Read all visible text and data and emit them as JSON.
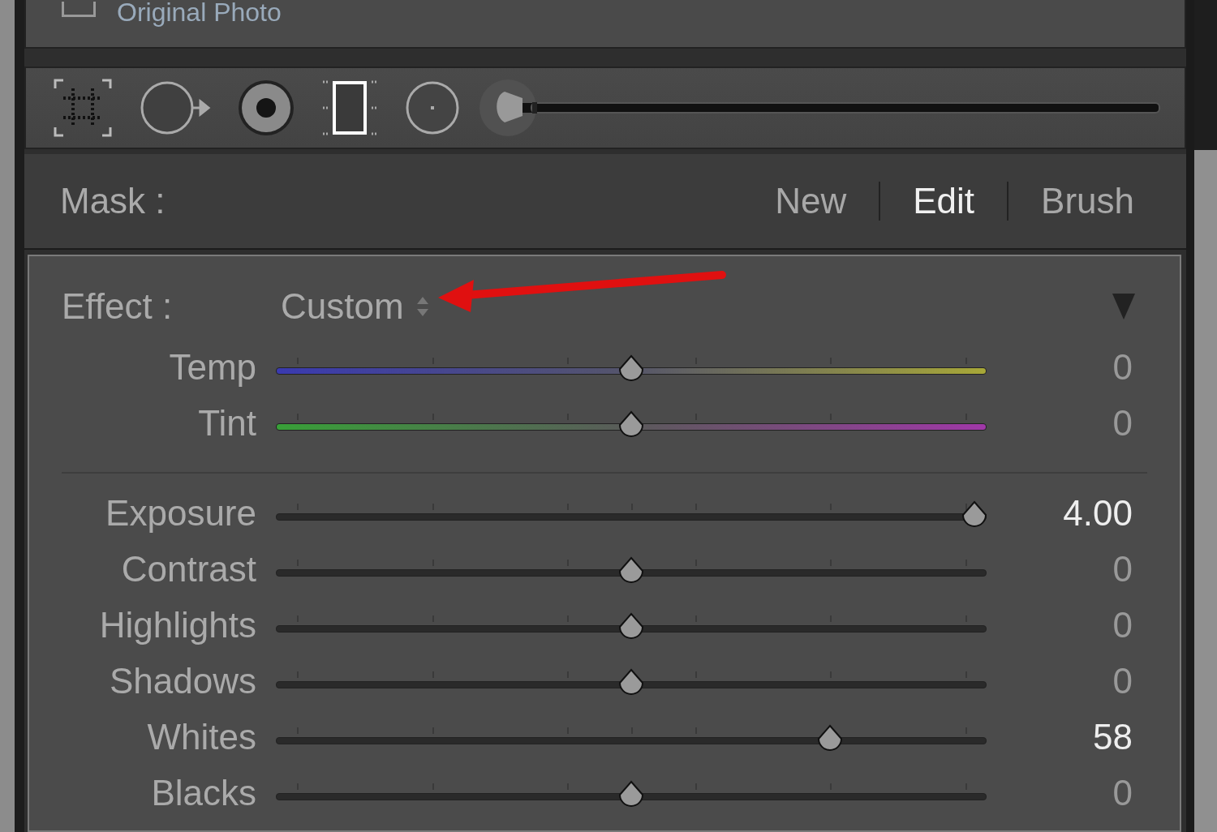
{
  "original_photo": {
    "label": "Original Photo",
    "checked": false
  },
  "tools": [
    {
      "kind": "marquee"
    },
    {
      "kind": "radial"
    },
    {
      "kind": "eye"
    },
    {
      "kind": "film"
    },
    {
      "kind": "dot"
    }
  ],
  "brush_size": {
    "level": 0
  },
  "mask": {
    "label": "Mask :",
    "tabs": [
      {
        "label": "New",
        "selected": false
      },
      {
        "label": "Edit",
        "selected": true
      },
      {
        "label": "Brush",
        "selected": false
      }
    ]
  },
  "effect": {
    "label": "Effect :",
    "value": "Custom",
    "expanded": true
  },
  "color_sliders": [
    {
      "kind": "temp",
      "label": "Temp",
      "level": 0.5,
      "reading": "0"
    },
    {
      "kind": "tint",
      "label": "Tint",
      "level": 0.5,
      "reading": "0"
    }
  ],
  "tone_sliders": [
    {
      "kind": "tone",
      "label": "Exposure",
      "level": 0.983,
      "reading": "4.00"
    },
    {
      "kind": "tone",
      "label": "Contrast",
      "level": 0.5,
      "reading": "0"
    },
    {
      "kind": "tone",
      "label": "Highlights",
      "level": 0.5,
      "reading": "0"
    },
    {
      "kind": "tone",
      "label": "Shadows",
      "level": 0.5,
      "reading": "0"
    },
    {
      "kind": "tone",
      "label": "Whites",
      "level": 0.78,
      "reading": "58"
    },
    {
      "kind": "tone",
      "label": "Blacks",
      "level": 0.5,
      "reading": "0"
    }
  ]
}
